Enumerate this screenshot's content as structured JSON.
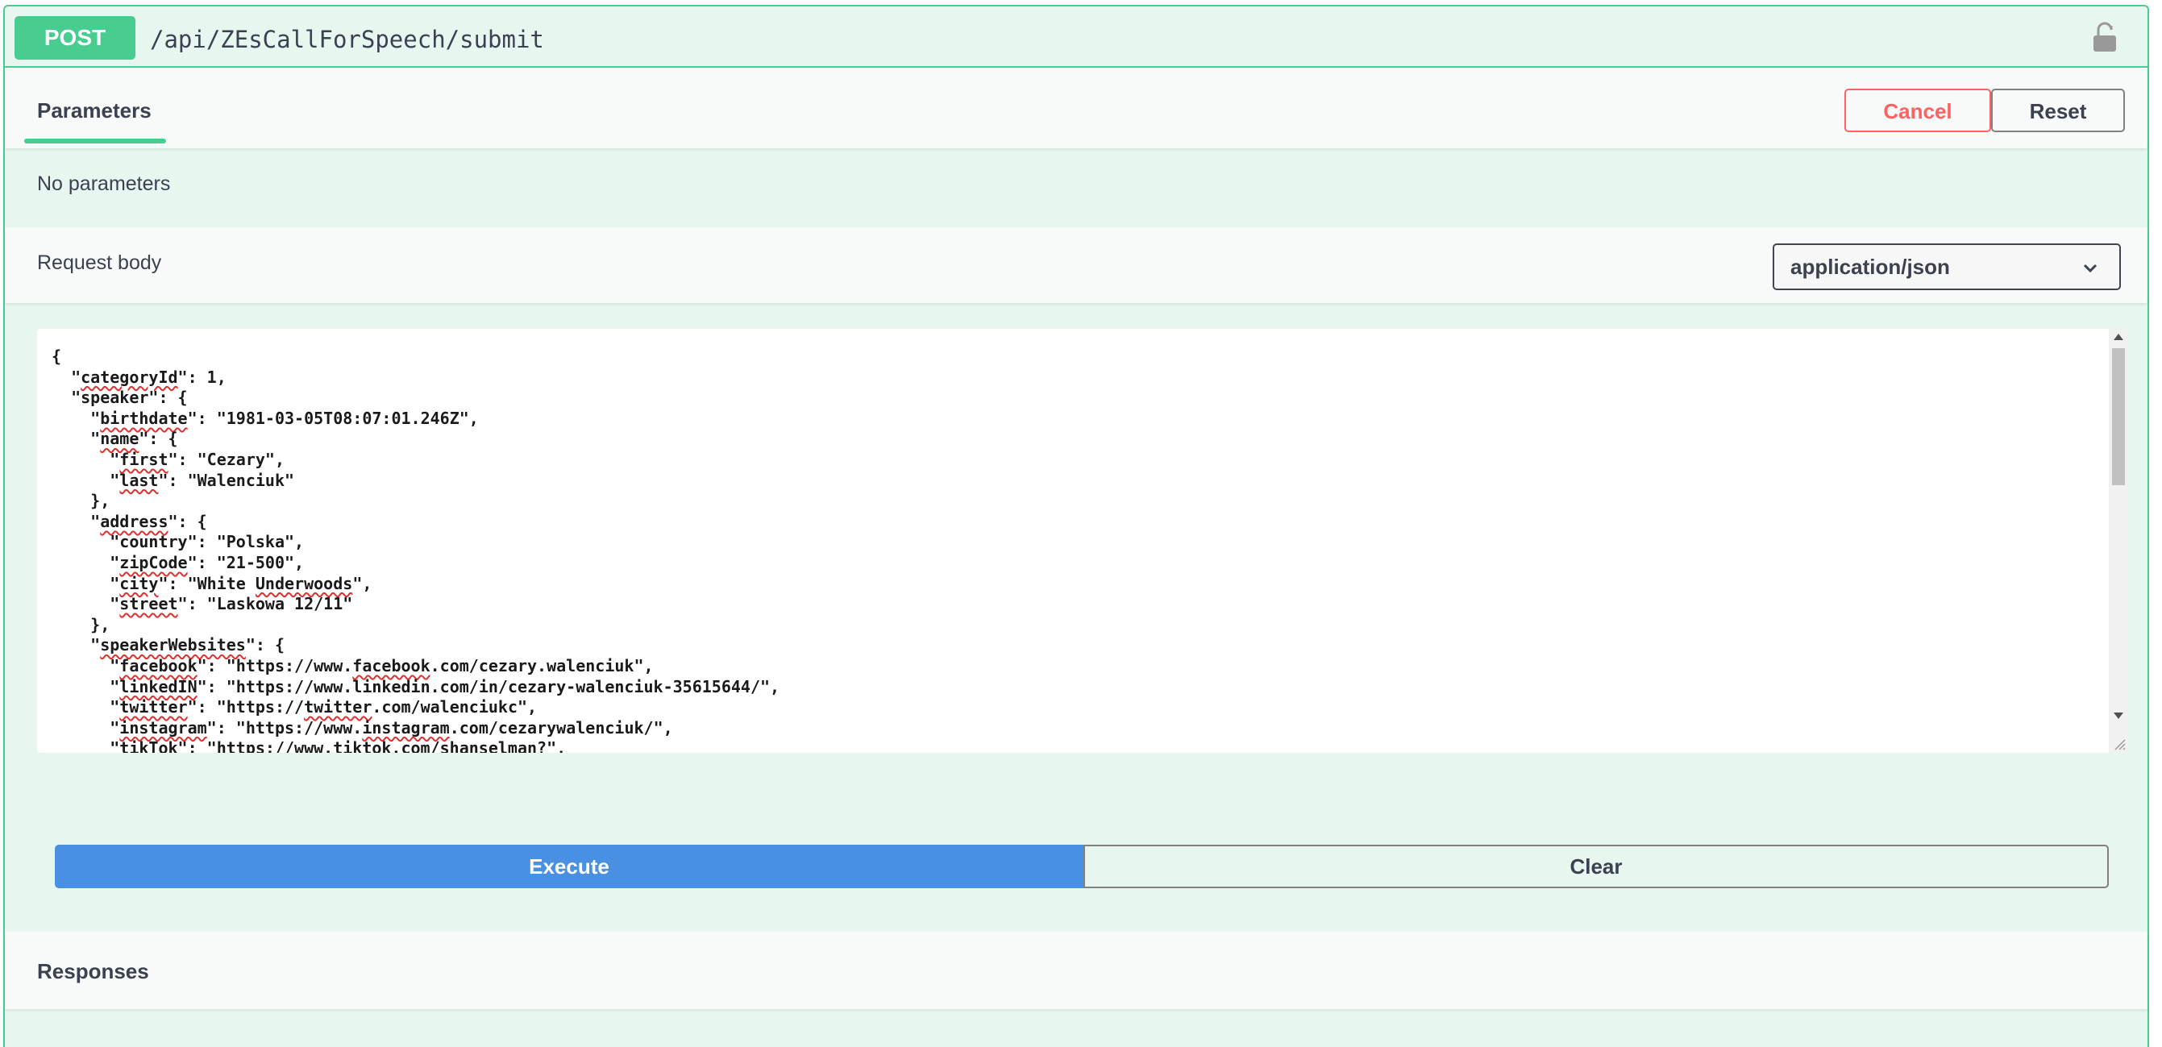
{
  "operation": {
    "method": "POST",
    "path": "/api/ZEsCallForSpeech/submit"
  },
  "parameters": {
    "tab_label": "Parameters",
    "cancel_label": "Cancel",
    "reset_label": "Reset",
    "empty_text": "No parameters"
  },
  "request_body": {
    "title": "Request body",
    "content_type": "application/json",
    "lines": [
      "{",
      "  \"categoryId\": 1,",
      "  \"speaker\": {",
      "    \"birthdate\": \"1981-03-05T08:07:01.246Z\",",
      "    \"name\": {",
      "      \"first\": \"Cezary\",",
      "      \"last\": \"Walenciuk\"",
      "    },",
      "    \"address\": {",
      "      \"country\": \"Polska\",",
      "      \"zipCode\": \"21-500\",",
      "      \"city\": \"White Underwoods\",",
      "      \"street\": \"Laskowa 12/11\"",
      "    },",
      "    \"speakerWebsites\": {",
      "      \"facebook\": \"https://www.facebook.com/cezary.walenciuk\",",
      "      \"linkedIN\": \"https://www.linkedin.com/in/cezary-walenciuk-35615644/\",",
      "      \"twitter\": \"https://twitter.com/walenciukc\",",
      "      \"instagram\": \"https://www.instagram.com/cezarywalenciuk/\",",
      "      \"tikTok\": \"https://www.tiktok.com/shanselman?\","
    ]
  },
  "actions": {
    "execute_label": "Execute",
    "clear_label": "Clear"
  },
  "responses": {
    "title": "Responses"
  },
  "colors": {
    "post_accent": "#49cc90",
    "execute_blue": "#4990e2",
    "cancel_red": "#ff6060"
  },
  "icons": {
    "lock": "lock-icon",
    "dropdown": "chevron-down-icon"
  }
}
